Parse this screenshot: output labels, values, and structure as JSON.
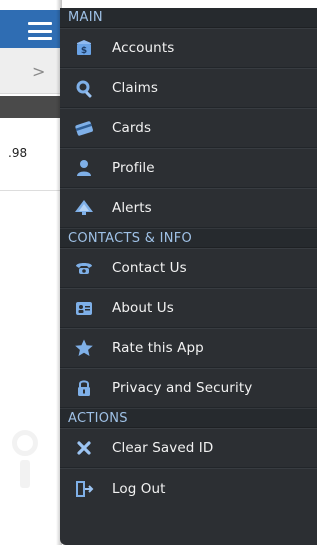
{
  "background": {
    "chevron": ">",
    "partial_value": ".98"
  },
  "drawer": {
    "sections": [
      {
        "title": "MAIN",
        "items": [
          {
            "label": "Accounts",
            "icon": "bank-icon"
          },
          {
            "label": "Claims",
            "icon": "claims-icon"
          },
          {
            "label": "Cards",
            "icon": "card-icon"
          },
          {
            "label": "Profile",
            "icon": "person-icon"
          },
          {
            "label": "Alerts",
            "icon": "alert-icon"
          }
        ]
      },
      {
        "title": "CONTACTS & INFO",
        "items": [
          {
            "label": "Contact Us",
            "icon": "phone-icon"
          },
          {
            "label": "About Us",
            "icon": "id-card-icon"
          },
          {
            "label": "Rate this App",
            "icon": "star-icon"
          },
          {
            "label": "Privacy and Security",
            "icon": "lock-icon"
          }
        ]
      },
      {
        "title": "ACTIONS",
        "items": [
          {
            "label": "Clear Saved ID",
            "icon": "x-icon"
          },
          {
            "label": "Log Out",
            "icon": "logout-icon"
          }
        ]
      }
    ]
  },
  "colors": {
    "header_blue": "#2f6db3",
    "drawer_bg": "#2c2f33",
    "section_text": "#9fc1e6",
    "icon_blue": "#7fb0e8"
  }
}
